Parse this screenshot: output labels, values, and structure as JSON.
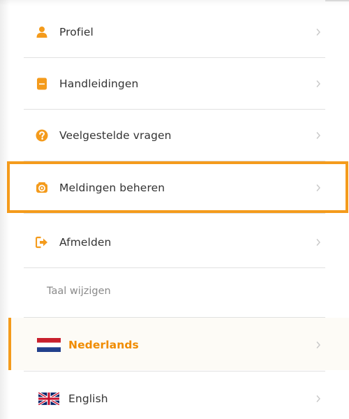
{
  "menu": {
    "items": [
      {
        "label": "Profiel",
        "icon": "user-icon"
      },
      {
        "label": "Handleidingen",
        "icon": "book-icon"
      },
      {
        "label": "Veelgestelde vragen",
        "icon": "question-circle-icon"
      },
      {
        "label": "Meldingen beheren",
        "icon": "notification-settings-icon",
        "highlighted": true
      },
      {
        "label": "Afmelden",
        "icon": "sign-out-icon"
      }
    ]
  },
  "language": {
    "heading": "Taal wijzigen",
    "options": [
      {
        "label": "Nederlands",
        "icon": "dutch-flag-icon",
        "active": true
      },
      {
        "label": "English",
        "icon": "uk-flag-icon",
        "active": false
      }
    ]
  },
  "colors": {
    "accent": "#f49b1c",
    "active_text": "#f08c00",
    "divider": "#e1e1e1",
    "chevron": "#c8c8c8"
  }
}
